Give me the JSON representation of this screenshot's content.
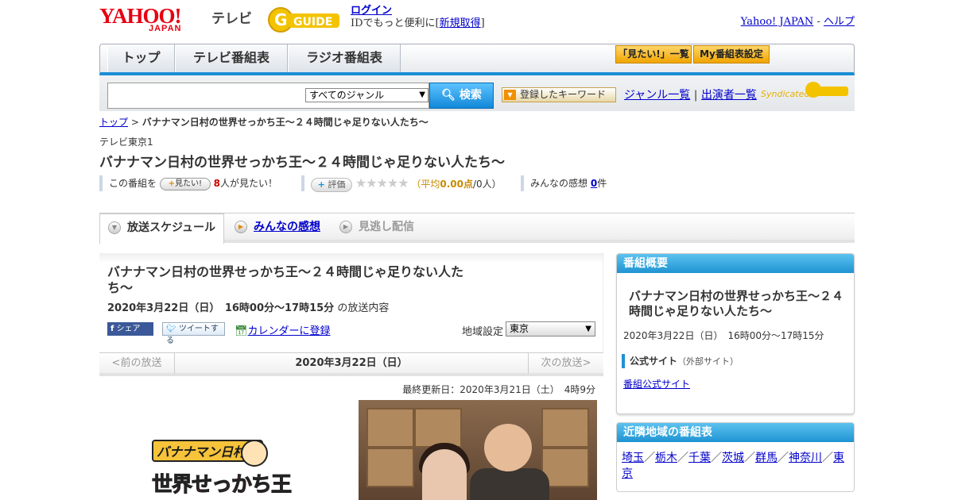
{
  "header": {
    "logo_yahoo": "YAHOO!",
    "logo_japan": "JAPAN",
    "logo_tv": "テレビ",
    "logo_gguide": "GUIDE",
    "login": "ログイン",
    "login_sub_prefix": "IDでもっと便利に[",
    "signup": "新規取得",
    "login_sub_suffix": "]",
    "yahoo_japan_link": "Yahoo! JAPAN",
    "sep": "-",
    "help_link": "ヘルプ"
  },
  "nav": {
    "tabs": [
      "トップ",
      "テレビ番組表",
      "ラジオ番組表"
    ],
    "watchlist_button": "「見たい!」一覧",
    "my_schedule_button": "My番組表設定"
  },
  "search": {
    "genre_select": "すべてのジャンル",
    "search_button": "検索",
    "keyword_button": "登録したキーワード",
    "genre_list_link": "ジャンル一覧",
    "divider": "|",
    "performer_list_link": "出演者一覧",
    "syndicated": "Syndicated"
  },
  "breadcrumb": {
    "top": "トップ",
    "sep": ">",
    "current": "バナナマン日村の世界せっかち王～２４時間じゃ足りない人たち～"
  },
  "program": {
    "channel": "テレビ東京1",
    "title": "バナナマン日村の世界せっかち王～２４時間じゃ足りない人たち～",
    "rating_prefix": "この番組を",
    "mitai_button": "見たい!",
    "mitai_count": "8",
    "mitai_suffix": "人が見たい！",
    "hyoka_button": "評価",
    "stars": "★★★★★",
    "avg_prefix": "（平均",
    "avg_value": "0.00点",
    "avg_suffix": "/0人）",
    "reviews_prefix": "みんなの感想",
    "reviews_count": "0",
    "reviews_suffix": "件"
  },
  "subtabs": {
    "schedule": "放送スケジュール",
    "reviews": "みんなの感想",
    "streaming": "見逃し配信"
  },
  "broadcast": {
    "title": "バナナマン日村の世界せっかち王～２４時間じゃ足りない人たち～",
    "datetime": "2020年3月22日（日）　16時00分～17時15分",
    "datetime_suffix": "の放送内容",
    "share_fb": "シェア",
    "tweet": "ツイートする",
    "calendar": "カレンダーに登録",
    "region_label": "地域設定",
    "region_value": "東京",
    "prev": "<前の放送",
    "current_date": "2020年3月22日（日）",
    "next": "次の放送>",
    "updated": "最終更新日：2020年3月21日（土）　4時9分",
    "logo_top": "バナナマン日村の",
    "logo_main": "世界せっかち王"
  },
  "overview": {
    "heading": "番組概要",
    "title": "バナナマン日村の世界せっかち王～２４時間じゃ足りない人たち～",
    "datetime": "2020年3月22日（日）　16時00分～17時15分",
    "official_label": "公式サイト",
    "official_note": "（外部サイト）",
    "official_link": "番組公式サイト"
  },
  "nearby": {
    "heading": "近隣地域の番組表",
    "regions": [
      "埼玉",
      "栃木",
      "千葉",
      "茨城",
      "群馬",
      "神奈川",
      "東京"
    ],
    "sep": "／"
  }
}
